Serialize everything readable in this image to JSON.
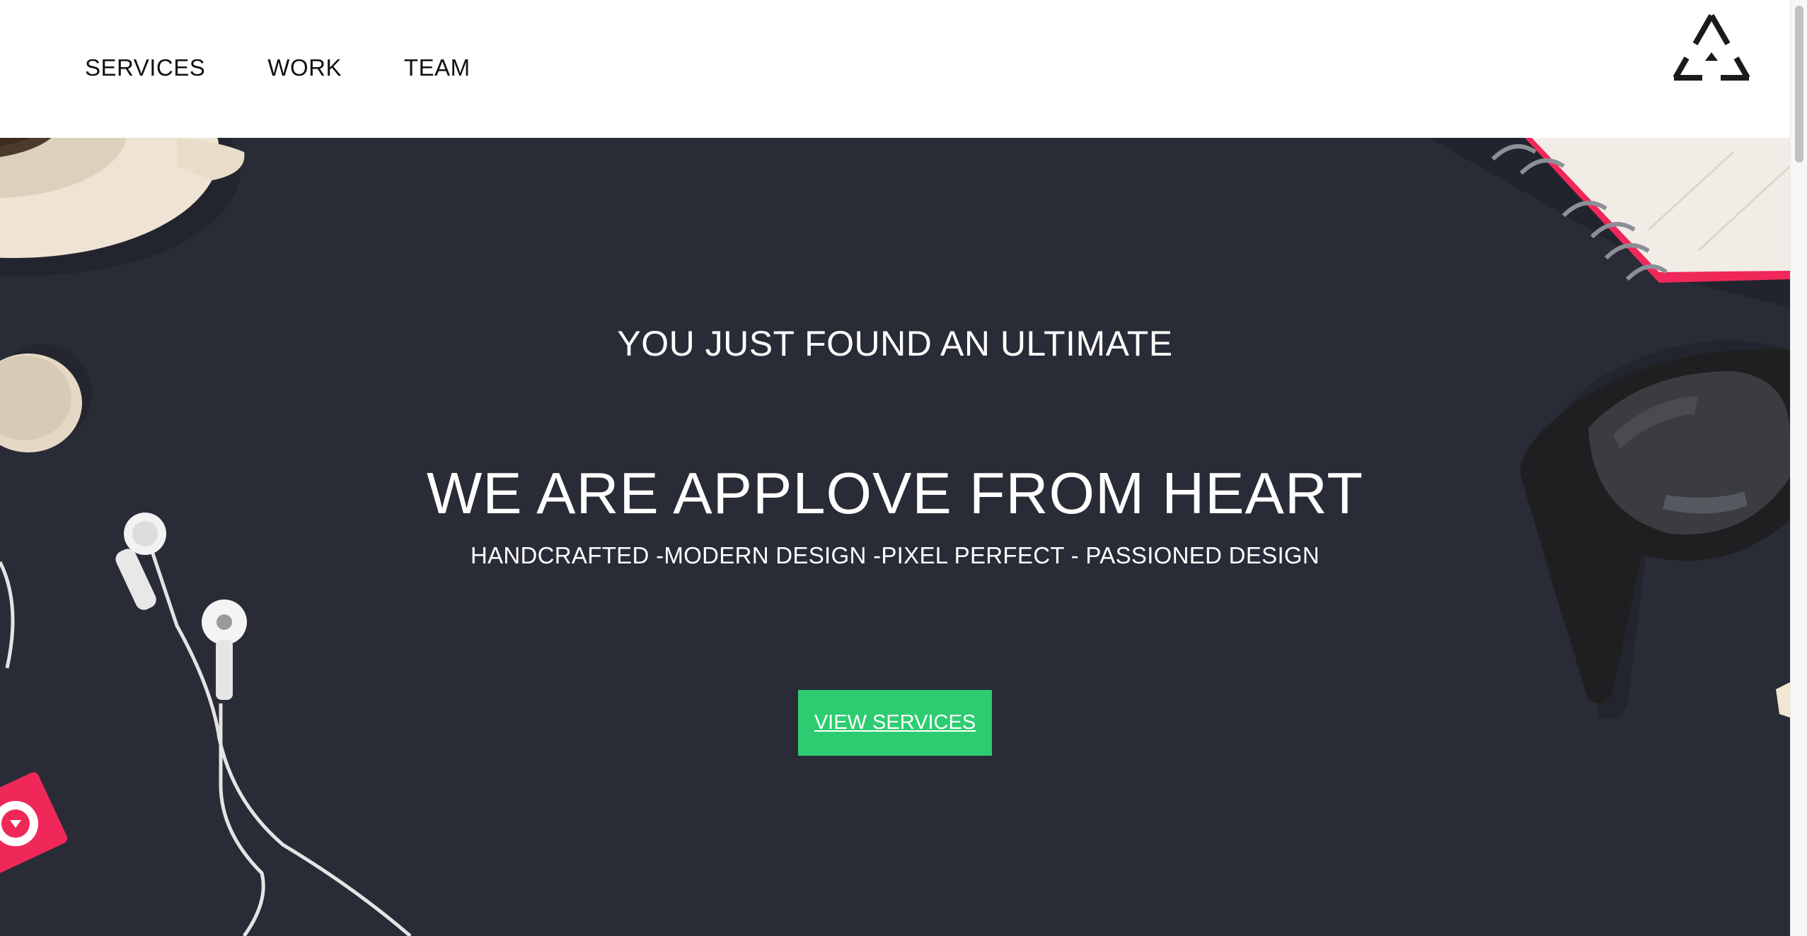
{
  "nav": {
    "items": [
      {
        "label": "SERVICES"
      },
      {
        "label": "WORK"
      },
      {
        "label": "TEAM"
      }
    ]
  },
  "logo": {
    "icon": "triangle-logo-icon"
  },
  "hero": {
    "tagline": "YOU JUST FOUND AN ULTIMATE",
    "headline": "WE ARE APPLOVE FROM HEART",
    "subline": "HANDCRAFTED -MODERN DESIGN -PIXEL PERFECT - PASSIONED DESIGN",
    "cta_label": "VIEW SERVICES"
  },
  "colors": {
    "header_bg": "#ffffff",
    "hero_bg": "#292c36",
    "cta_bg": "#2ecc71",
    "accent_pink": "#f0285a"
  }
}
